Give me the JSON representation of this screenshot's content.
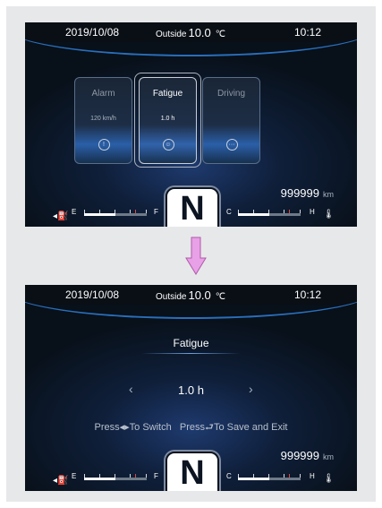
{
  "top_screen": {
    "date": "2019/10/08",
    "outside_label": "Outside",
    "outside_value": "10.0",
    "outside_unit": "℃",
    "time": "10:12",
    "cards": [
      {
        "title": "Alarm",
        "value": "120 km/h",
        "icon": "info-icon",
        "glyph": "!",
        "selected": false
      },
      {
        "title": "Fatigue",
        "value": "1.0 h",
        "icon": "person-icon",
        "glyph": "☺",
        "selected": true
      },
      {
        "title": "Driving",
        "value": "",
        "icon": "more-icon",
        "glyph": "···",
        "selected": false
      }
    ],
    "odometer": "999999",
    "odometer_unit": "km",
    "gear": "N",
    "fuel_gauge": {
      "empty_label": "E",
      "full_label": "F",
      "level": 0.5
    },
    "temp_gauge": {
      "cold_label": "C",
      "hot_label": "H",
      "level": 0.5
    }
  },
  "bottom_screen": {
    "date": "2019/10/08",
    "outside_label": "Outside",
    "outside_value": "10.0",
    "outside_unit": "℃",
    "time": "10:12",
    "title": "Fatigue",
    "value": "1.0 h",
    "hint_switch_prefix": "Press",
    "hint_switch_suffix": "To Switch",
    "hint_save_prefix": "Press",
    "hint_save_suffix": "To Save and Exit",
    "odometer": "999999",
    "odometer_unit": "km",
    "gear": "N",
    "fuel_gauge": {
      "empty_label": "E",
      "full_label": "F",
      "level": 0.5
    },
    "temp_gauge": {
      "cold_label": "C",
      "hot_label": "H",
      "level": 0.5
    }
  },
  "colors": {
    "accent": "#2f7fd8",
    "screen_bg": "#0b1420",
    "frame_bg": "#e7e8ea",
    "transition_arrow": "#e8a0e6"
  }
}
